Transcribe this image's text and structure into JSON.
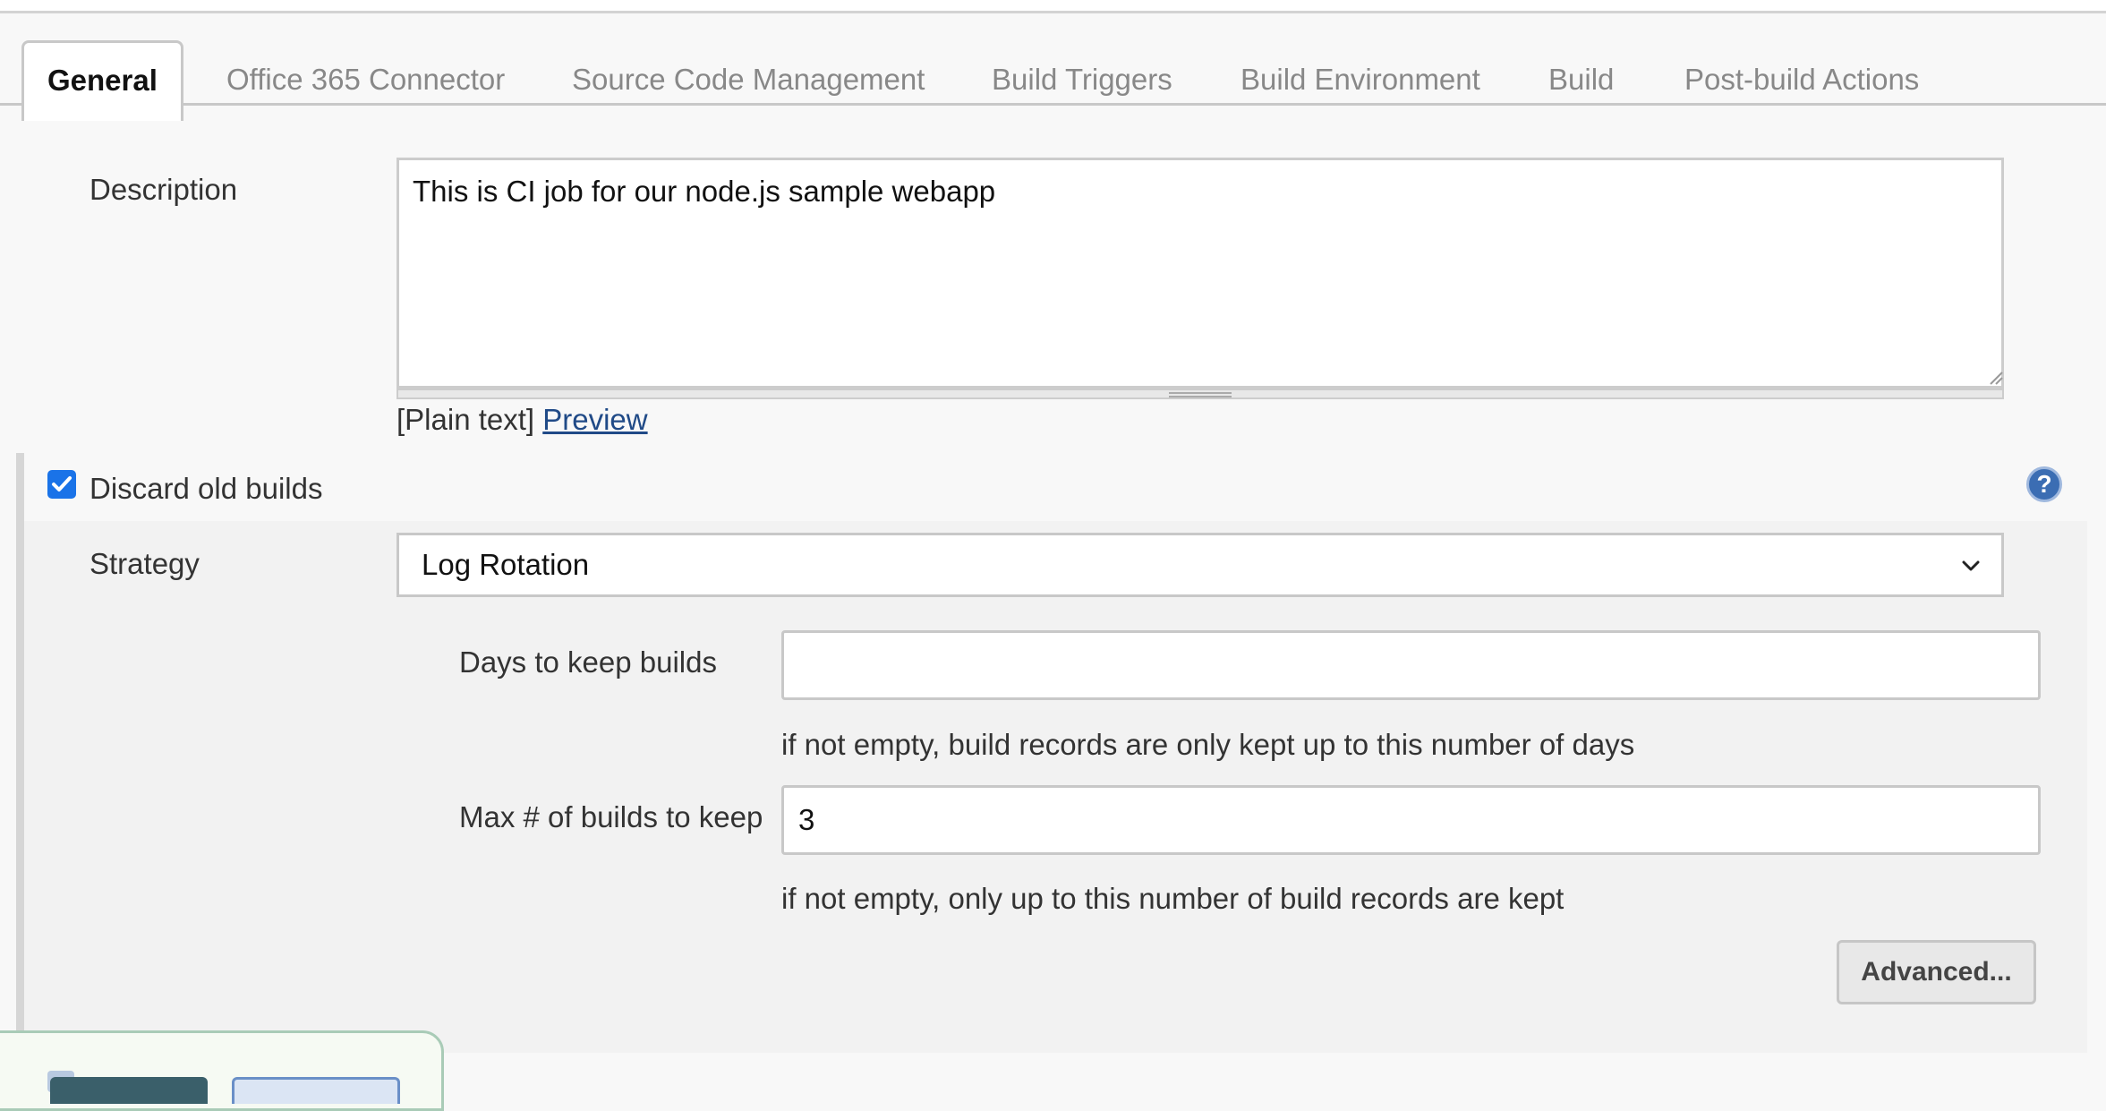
{
  "tabs": [
    {
      "label": "General",
      "active": true
    },
    {
      "label": "Office 365 Connector"
    },
    {
      "label": "Source Code Management"
    },
    {
      "label": "Build Triggers"
    },
    {
      "label": "Build Environment"
    },
    {
      "label": "Build"
    },
    {
      "label": "Post-build Actions"
    }
  ],
  "general": {
    "description_label": "Description",
    "description_value": "This is CI job for our node.js sample webapp",
    "plain_text_label": "[Plain text]",
    "preview_link": "Preview",
    "discard_old_builds": {
      "label": "Discard old builds",
      "checked": true
    },
    "strategy_label": "Strategy",
    "strategy_value": "Log Rotation",
    "days_label": "Days to keep builds",
    "days_value": "",
    "days_hint": "if not empty, build records are only kept up to this number of days",
    "max_label": "Max # of builds to keep",
    "max_value": "3",
    "max_hint": "if not empty, only up to this number of build records are kept",
    "advanced_label": "Advanced..."
  },
  "colors": {
    "checkbox_checked": "#1a73e8",
    "help_icon": "#3b6db3",
    "link": "#204a87"
  },
  "icons": [
    "check-icon",
    "help-icon",
    "chevron-down-icon",
    "resize-grip-icon"
  ]
}
